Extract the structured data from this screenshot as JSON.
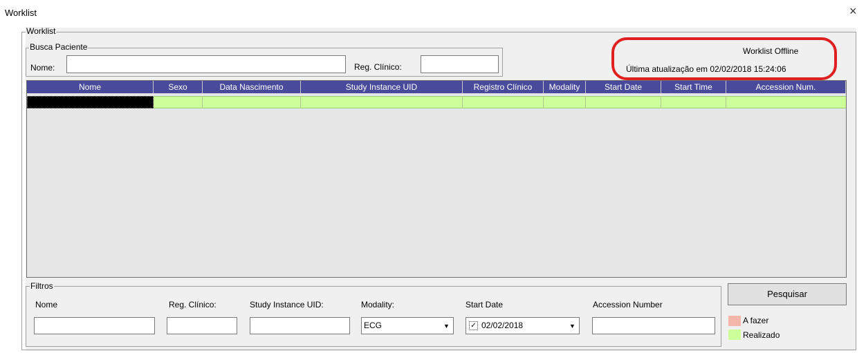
{
  "window": {
    "title": "Worklist",
    "close_glyph": "×"
  },
  "worklist_group": {
    "legend": "Worklist"
  },
  "busca": {
    "legend": "Busca Paciente",
    "nome_label": "Nome:",
    "nome_value": "",
    "reg_label": "Reg. Clínico:",
    "reg_value": ""
  },
  "status": {
    "state": "Worklist Offline",
    "last_update": "Última atualização em 02/02/2018 15:24:06"
  },
  "table": {
    "columns": [
      "Nome",
      "Sexo",
      "Data Nascimento",
      "Study Instance UID",
      "Registro Clínico",
      "Modality",
      "Start Date",
      "Start Time",
      "Accession Num."
    ],
    "rows": [
      {
        "nome": "",
        "sexo": "",
        "data_nascimento": "",
        "study_uid": "",
        "registro": "",
        "modality": "",
        "start_date": "",
        "start_time": "",
        "accession": ""
      }
    ]
  },
  "filtros": {
    "legend": "Filtros",
    "nome_label": "Nome",
    "nome_value": "",
    "reg_label": "Reg. Clínico:",
    "reg_value": "",
    "uid_label": "Study Instance UID:",
    "uid_value": "",
    "modality_label": "Modality:",
    "modality_value": "ECG",
    "start_date_label": "Start Date",
    "start_date_value": "02/02/2018",
    "start_date_checked": true,
    "accession_label": "Accession Number",
    "accession_value": ""
  },
  "actions": {
    "search_label": "Pesquisar"
  },
  "legend_colors": {
    "a_fazer_label": "A fazer",
    "realizado_label": "Realizado",
    "a_fazer_color": "#f4b6a8",
    "realizado_color": "#ccff99"
  },
  "colors": {
    "header_bg": "#4a4a9c",
    "highlight": "#e0201e"
  }
}
